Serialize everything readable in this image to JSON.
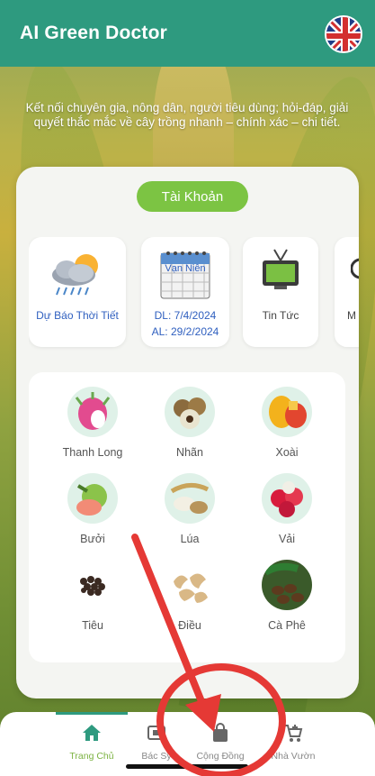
{
  "app_bar": {
    "title": "AI Green Doctor",
    "language_flag_icon": "uk-flag-icon"
  },
  "tagline": "Kết nối chuyên gia, nông dân, người tiêu dùng; hỏi-đáp, giải quyết thắc mắc về cây trồng nhanh – chính xác – chi tiết.",
  "account_button": "Tài Khoản",
  "features": [
    {
      "label": "Dự Báo Thời Tiết",
      "icon": "weather-icon"
    },
    {
      "label": "DL: 7/4/2024",
      "label2": "AL: 29/2/2024",
      "icon": "calendar-icon",
      "icon_text": "Vạn Niên"
    },
    {
      "label": "Tin Tức",
      "icon": "tv-icon"
    },
    {
      "label": "M",
      "icon": "partial-icon"
    }
  ],
  "crops": [
    {
      "label": "Thanh Long",
      "icon": "dragon-fruit-icon"
    },
    {
      "label": "Nhãn",
      "icon": "longan-icon"
    },
    {
      "label": "Xoài",
      "icon": "mango-icon"
    },
    {
      "label": "Bưởi",
      "icon": "pomelo-icon"
    },
    {
      "label": "Lúa",
      "icon": "rice-icon"
    },
    {
      "label": "Vải",
      "icon": "lychee-icon"
    },
    {
      "label": "Tiêu",
      "icon": "pepper-icon"
    },
    {
      "label": "Điều",
      "icon": "cashew-icon"
    },
    {
      "label": "Cà Phê",
      "icon": "coffee-icon"
    }
  ],
  "bottom_nav": [
    {
      "label": "Trang Chủ",
      "icon": "home-icon",
      "active": true
    },
    {
      "label": "Bác Sỹ",
      "icon": "doctor-icon",
      "active": false
    },
    {
      "label": "Cộng Đồng",
      "icon": "bag-icon",
      "active": false
    },
    {
      "label": "Nhà Vườn",
      "icon": "cart-icon",
      "active": false
    }
  ],
  "colors": {
    "primary": "#2e9a7f",
    "accent_green": "#7cc443",
    "annotation_red": "#e53935"
  }
}
